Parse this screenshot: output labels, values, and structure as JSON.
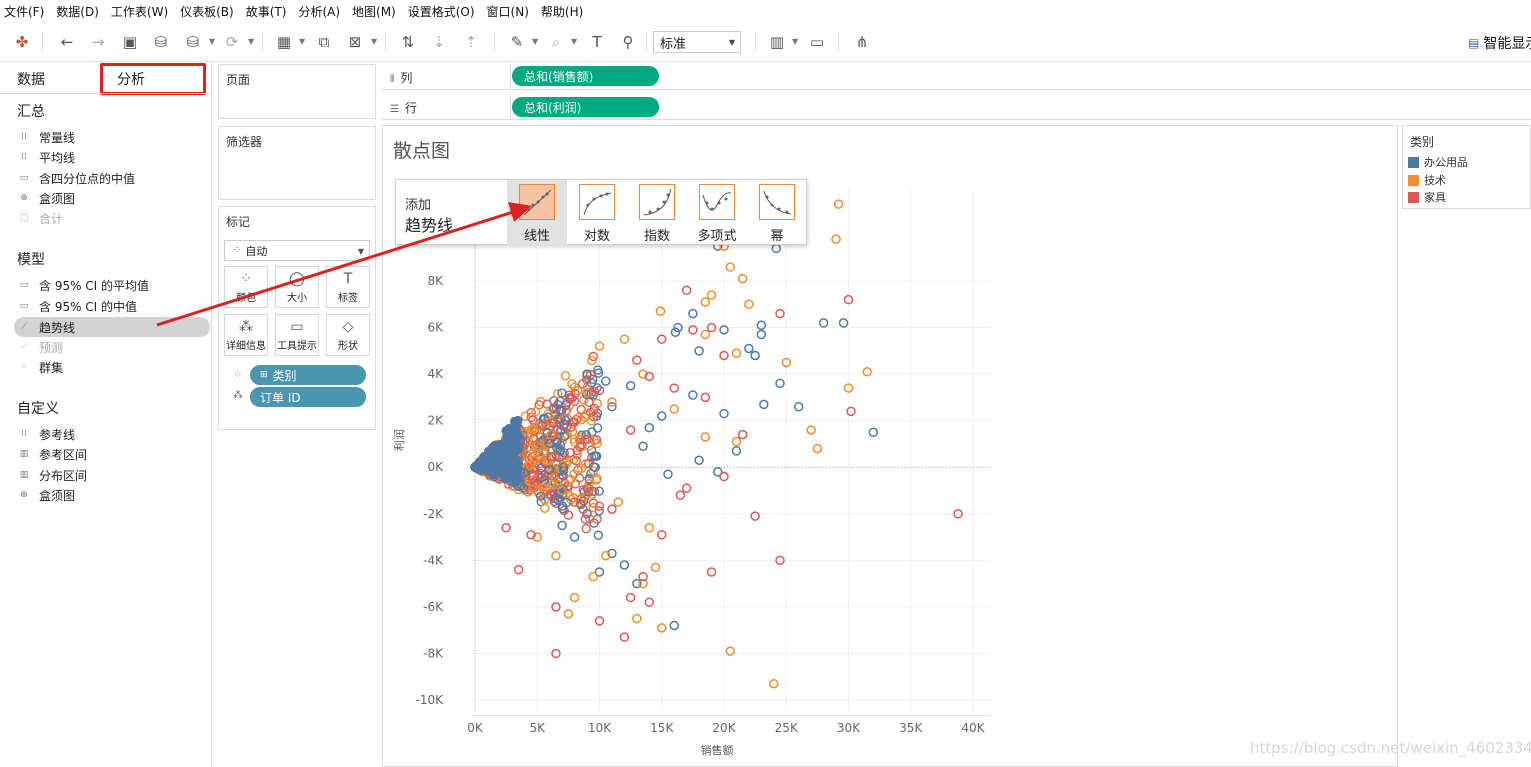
{
  "menu": [
    "文件(F)",
    "数据(D)",
    "工作表(W)",
    "仪表板(B)",
    "故事(T)",
    "分析(A)",
    "地图(M)",
    "设置格式(O)",
    "窗口(N)",
    "帮助(H)"
  ],
  "toolbar": {
    "fit_value": "标准",
    "smart_display_label": "智能显示"
  },
  "left_panel": {
    "tab_data": "数据",
    "tab_analysis": "分析",
    "summary_header": "汇总",
    "summary_items": [
      "常量线",
      "平均线",
      "含四分位点的中值",
      "盒须图",
      "合计"
    ],
    "model_header": "模型",
    "model_items": [
      "含 95% CI 的平均值",
      "含 95% CI 的中值",
      "趋势线",
      "预测",
      "群集"
    ],
    "custom_header": "自定义",
    "custom_items": [
      "参考线",
      "参考区间",
      "分布区间",
      "盒须图"
    ]
  },
  "cards": {
    "pages": "页面",
    "filters": "筛选器",
    "marks": "标记",
    "marks_type": "自动",
    "mark_buttons": [
      "颜色",
      "大小",
      "标签",
      "详细信息",
      "工具提示",
      "形状"
    ],
    "mark_pills": [
      "类别",
      "订单 ID"
    ]
  },
  "shelves": {
    "columns_label": "列",
    "columns_pill": "总和(销售额)",
    "rows_label": "行",
    "rows_pill": "总和(利润)"
  },
  "view": {
    "sheet_title": "散点图"
  },
  "trend_popup": {
    "add_label": "添加",
    "title": "趋势线",
    "options": [
      "线性",
      "对数",
      "指数",
      "多项式",
      "幂"
    ],
    "selected": "线性"
  },
  "legend": {
    "title": "类别",
    "items": [
      {
        "label": "办公用品",
        "color": "#4e79a7"
      },
      {
        "label": "技术",
        "color": "#f28e2b"
      },
      {
        "label": "家具",
        "color": "#e15759"
      }
    ]
  },
  "watermark": "https://blog.csdn.net/weixin_46023346",
  "colors": {
    "highlight_red": "#e02020",
    "pill_green": "#00a980",
    "pill_blue": "#4a96b0",
    "trend_orange": "#e8893a"
  },
  "chart_data": {
    "type": "scatter",
    "xlabel": "销售额",
    "ylabel": "利润",
    "x_ticks": [
      "0K",
      "5K",
      "10K",
      "15K",
      "20K",
      "25K",
      "30K",
      "35K",
      "40K"
    ],
    "y_ticks": [
      "-10K",
      "-8K",
      "-6K",
      "-4K",
      "-2K",
      "0K",
      "2K",
      "4K",
      "6K",
      "8K"
    ],
    "xlim": [
      0,
      40500
    ],
    "ylim": [
      -10500,
      12000
    ],
    "note_units": "x and y in currency units",
    "series": [
      {
        "name": "办公用品",
        "points": [
          [
            19500,
            9500
          ],
          [
            24200,
            9400
          ],
          [
            28000,
            6200
          ],
          [
            29600,
            6200
          ],
          [
            23000,
            5700
          ],
          [
            16100,
            5800
          ],
          [
            16300,
            6000
          ],
          [
            17500,
            6600
          ],
          [
            18000,
            5000
          ],
          [
            20000,
            5900
          ],
          [
            22000,
            5100
          ],
          [
            22500,
            4800
          ],
          [
            23000,
            6100
          ],
          [
            24500,
            3600
          ],
          [
            26000,
            2600
          ],
          [
            32000,
            1500
          ],
          [
            23200,
            2700
          ],
          [
            20000,
            2300
          ],
          [
            17500,
            3100
          ],
          [
            15000,
            2200
          ],
          [
            14000,
            1700
          ],
          [
            16000,
            -6800
          ],
          [
            12000,
            -4200
          ],
          [
            10000,
            -4500
          ],
          [
            13000,
            -5000
          ],
          [
            11000,
            -3700
          ],
          [
            8000,
            -3000
          ],
          [
            7000,
            -2500
          ],
          [
            9000,
            -2000
          ],
          [
            8500,
            -1600
          ],
          [
            21000,
            700
          ],
          [
            18000,
            300
          ],
          [
            15500,
            -300
          ],
          [
            13500,
            900
          ],
          [
            19500,
            -200
          ],
          [
            9000,
            4000
          ],
          [
            10500,
            3700
          ],
          [
            12500,
            3500
          ],
          [
            11000,
            2600
          ]
        ]
      },
      {
        "name": "技术",
        "points": [
          [
            29200,
            11300
          ],
          [
            29000,
            9800
          ],
          [
            20000,
            9500
          ],
          [
            20500,
            8600
          ],
          [
            21500,
            8100
          ],
          [
            19000,
            7400
          ],
          [
            18500,
            7100
          ],
          [
            22000,
            7000
          ],
          [
            14900,
            6700
          ],
          [
            18500,
            5700
          ],
          [
            21000,
            4900
          ],
          [
            25000,
            4500
          ],
          [
            30000,
            3400
          ],
          [
            31500,
            4100
          ],
          [
            27000,
            1600
          ],
          [
            27500,
            800
          ],
          [
            21000,
            1100
          ],
          [
            18500,
            1300
          ],
          [
            16000,
            2500
          ],
          [
            13500,
            4000
          ],
          [
            12000,
            5500
          ],
          [
            10000,
            5200
          ],
          [
            7500,
            -6300
          ],
          [
            8000,
            -5600
          ],
          [
            9500,
            -4700
          ],
          [
            10500,
            -3800
          ],
          [
            13500,
            -5000
          ],
          [
            14500,
            -4300
          ],
          [
            15000,
            -6900
          ],
          [
            13000,
            -6500
          ],
          [
            14000,
            -2600
          ],
          [
            20500,
            -7900
          ],
          [
            24000,
            -9300
          ],
          [
            11500,
            -1500
          ],
          [
            6500,
            -3800
          ],
          [
            5000,
            -3000
          ],
          [
            7000,
            -1000
          ],
          [
            9000,
            3200
          ],
          [
            11000,
            2800
          ]
        ]
      },
      {
        "name": "家具",
        "points": [
          [
            17000,
            7600
          ],
          [
            30000,
            7200
          ],
          [
            24500,
            6600
          ],
          [
            17500,
            5900
          ],
          [
            19000,
            6000
          ],
          [
            20000,
            4800
          ],
          [
            15000,
            5500
          ],
          [
            13000,
            4600
          ],
          [
            14000,
            3900
          ],
          [
            16000,
            3400
          ],
          [
            18500,
            3000
          ],
          [
            21500,
            1400
          ],
          [
            30200,
            2400
          ],
          [
            38800,
            -2000
          ],
          [
            24500,
            -4000
          ],
          [
            22500,
            -2100
          ],
          [
            20000,
            -400
          ],
          [
            19000,
            -4500
          ],
          [
            17000,
            -900
          ],
          [
            16500,
            -1200
          ],
          [
            15000,
            -2900
          ],
          [
            13500,
            -4700
          ],
          [
            14000,
            -5800
          ],
          [
            12500,
            -5600
          ],
          [
            12000,
            -7300
          ],
          [
            10000,
            -6600
          ],
          [
            6500,
            -6000
          ],
          [
            6500,
            -8000
          ],
          [
            3500,
            -4400
          ],
          [
            2500,
            -2600
          ],
          [
            4500,
            -2900
          ],
          [
            8000,
            -1500
          ],
          [
            11000,
            -1800
          ],
          [
            10000,
            3300
          ],
          [
            12500,
            1600
          ],
          [
            9000,
            1200
          ]
        ]
      }
    ],
    "cluster_region": "dense overlapping points from 0 to ~10K sales, -3K to 6K profit",
    "zero_line": true,
    "legend_position": "right"
  }
}
